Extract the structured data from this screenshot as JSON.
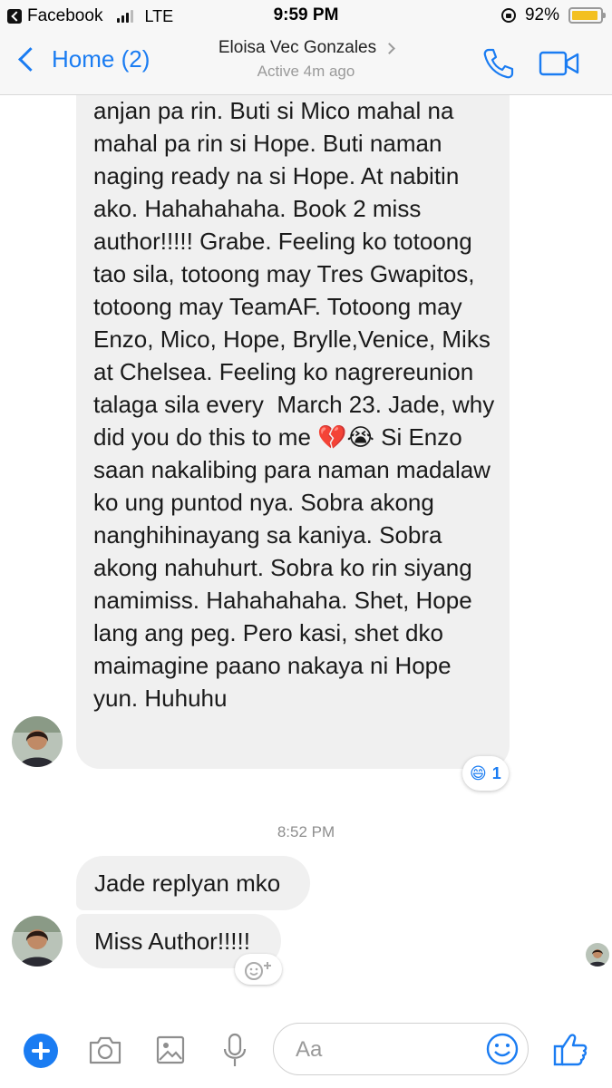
{
  "status_bar": {
    "back_app": "Facebook",
    "network": "LTE",
    "time": "9:59 PM",
    "battery": "92%",
    "battery_level": 0.92
  },
  "header": {
    "back_label": "Home (2)",
    "contact_name": "Eloisa Vec Gonzales",
    "active_status": "Active 4m ago"
  },
  "messages": [
    {
      "text": "anjan pa rin. Buti si Mico mahal na mahal pa rin si Hope. Buti naman naging ready na si Hope. At nabitin ako. Hahahahaha. Book 2 miss author!!!!! Grabe. Feeling ko totoong tao sila, totoong may Tres Gwapitos, totoong may TeamAF. Totoong may Enzo, Mico, Hope, Brylle,Venice, Miks at Chelsea. Feeling ko nagrereunion talaga sila every  March 23. Jade, why did you do this to me 💔😭 Si Enzo saan nakalibing para naman madalaw ko ung puntod nya. Sobra akong nanghihinayang sa kaniya. Sobra akong nahuhurt. Sobra ko rin siyang namimiss. Hahahahaha. Shet, Hope lang ang peg. Pero kasi, shet dko maimagine paano nakaya ni Hope yun. Huhuhu",
      "reaction": {
        "emoji": "😄",
        "count": "1"
      }
    },
    {
      "text": "Jade replyan mko"
    },
    {
      "text": "Miss Author!!!!!"
    }
  ],
  "timestamp": "8:52 PM",
  "composer": {
    "placeholder": "Aa"
  },
  "colors": {
    "accent": "#1a7cf2",
    "bubble": "#f0f0f0",
    "bar": "#f7f7f7"
  }
}
